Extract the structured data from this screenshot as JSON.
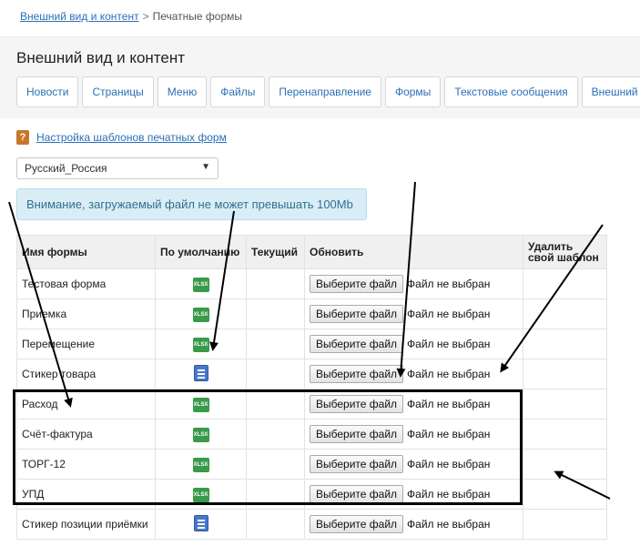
{
  "breadcrumb": {
    "link": "Внешний вид и контент",
    "separator": ">",
    "current": "Печатные формы"
  },
  "page_title": "Внешний вид и контент",
  "tabs": [
    "Новости",
    "Страницы",
    "Меню",
    "Файлы",
    "Перенаправление",
    "Формы",
    "Текстовые сообщения",
    "Внешний вид"
  ],
  "settings_link": {
    "icon": "help-book-icon",
    "label": "Настройка шаблонов печатных форм"
  },
  "language_select": {
    "value": "Русский_Россия"
  },
  "alert": "Внимание, загружаемый файл не может превышать 100Mb",
  "table": {
    "headers": {
      "name": "Имя формы",
      "default": "По умолчанию",
      "current": "Текущий",
      "update": "Обновить",
      "delete": "Удалить свой шаблон"
    },
    "button_label": "Выберите файл",
    "no_file_label": "Файл не выбран",
    "rows": [
      {
        "name": "Тестовая форма",
        "icon": "xlsx-icon"
      },
      {
        "name": "Приемка",
        "icon": "xlsx-icon"
      },
      {
        "name": "Перемещение",
        "icon": "xlsx-icon"
      },
      {
        "name": "Стикер товара",
        "icon": "doc-icon"
      },
      {
        "name": "Расход",
        "icon": "xlsx-icon"
      },
      {
        "name": "Счёт-фактура",
        "icon": "xlsx-icon"
      },
      {
        "name": "ТОРГ-12",
        "icon": "xlsx-icon"
      },
      {
        "name": "УПД",
        "icon": "xlsx-icon"
      },
      {
        "name": "Стикер позиции приёмки",
        "icon": "doc-icon"
      }
    ],
    "xlsx_icon_text": "XLSX"
  },
  "colors": {
    "link": "#2a6fb5",
    "alert_bg": "#d9edf7",
    "alert_text": "#31708f",
    "annotation": "#000000"
  }
}
